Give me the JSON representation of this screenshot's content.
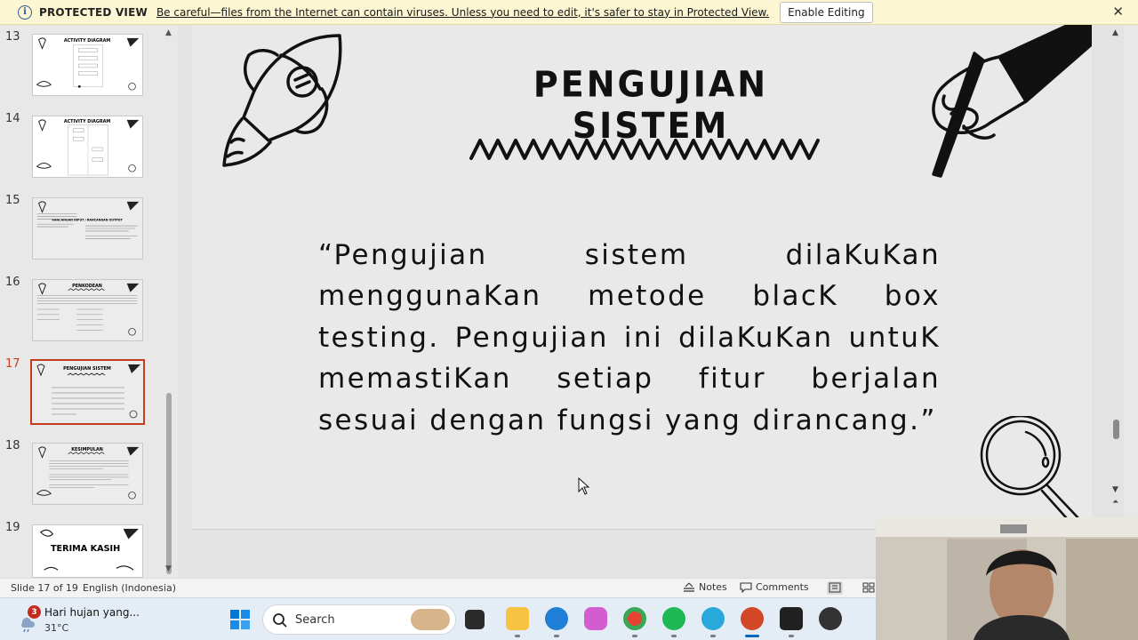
{
  "protected_view": {
    "title": "PROTECTED VIEW",
    "message": "Be careful—files from the Internet can contain viruses. Unless you need to edit, it's safer to stay in Protected View.",
    "enable_button": "Enable Editing",
    "info_icon": "info-shield-icon",
    "close_icon": "close-icon"
  },
  "thumbnails": [
    {
      "number": "13",
      "label": "ACTIVITY DIAGRAM"
    },
    {
      "number": "14",
      "label": "ACTIVITY DIAGRAM"
    },
    {
      "number": "15",
      "label": "RANCANGAN INPUT / RANCANGAN OUTPUT"
    },
    {
      "number": "16",
      "label": "PENKODEAN"
    },
    {
      "number": "17",
      "label": "PENGUJIAN SISTEM",
      "active": true
    },
    {
      "number": "18",
      "label": "KESIMPULAN"
    },
    {
      "number": "19",
      "label": "TERIMA KASIH"
    }
  ],
  "slide": {
    "title": "PENGUJIAN SISTEM",
    "body": "“Pengujian sistem dilaKuKan menggunaKan metode blacK box testing. Pengujian ini dilaKuKan untuK memastiKan setiap fitur berjalan sesuai dengan fungsi yang dirancang.”"
  },
  "status_bar": {
    "slide_count": "Slide 17 of 19",
    "language": "English (Indonesia)",
    "notes": "Notes",
    "comments": "Comments"
  },
  "taskbar": {
    "weather_badge": "3",
    "weather_title": "Hari hujan yang...",
    "weather_temp": "31°C",
    "search_label": "Search"
  },
  "colors": {
    "accent_red": "#c43e1c",
    "protected_bar": "#fdf6d3",
    "taskbar": "#e4ecf6"
  }
}
